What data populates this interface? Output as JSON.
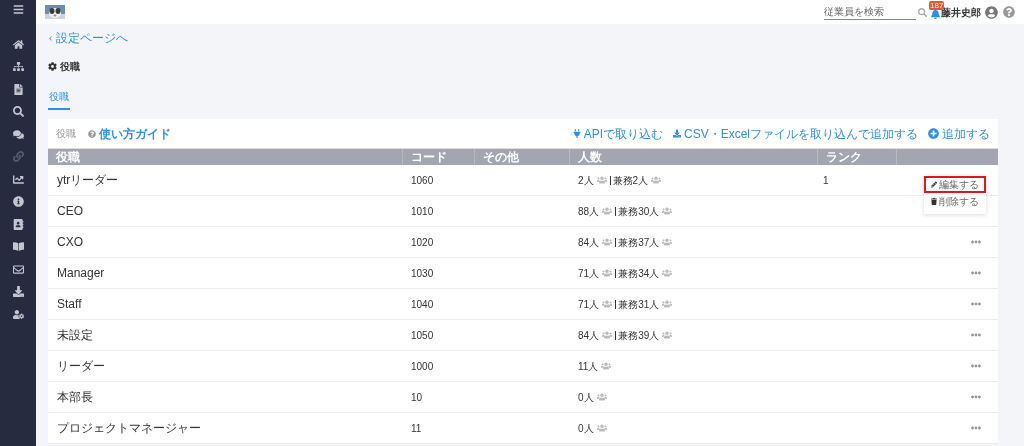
{
  "header": {
    "search": {
      "placeholder": "従業員を検索"
    },
    "notifications": {
      "count": "187"
    },
    "user": {
      "name": "藤井史郎"
    }
  },
  "sidebar": {
    "items": [
      {
        "kind": "menu"
      },
      {
        "kind": "home"
      },
      {
        "kind": "org"
      },
      {
        "kind": "file"
      },
      {
        "kind": "search"
      },
      {
        "kind": "chat"
      },
      {
        "kind": "link"
      },
      {
        "kind": "chart"
      },
      {
        "kind": "info"
      },
      {
        "kind": "contact"
      },
      {
        "kind": "book"
      },
      {
        "kind": "mail"
      },
      {
        "kind": "download"
      },
      {
        "kind": "usercog"
      }
    ]
  },
  "breadcrumb": "設定ページへ",
  "page_title": "役職",
  "tabs": [
    {
      "label": "役職",
      "selected": true
    }
  ],
  "toolbar": {
    "title": "役職",
    "guide": "使い方ガイド",
    "actions": [
      {
        "kind": "api",
        "label": "APIで取り込む"
      },
      {
        "kind": "import",
        "label": "CSV・Excelファイルを取り込んで追加する"
      },
      {
        "kind": "add",
        "label": "追加する"
      }
    ]
  },
  "table": {
    "columns": [
      "役職",
      "コード",
      "その他",
      "人数",
      "ランク"
    ],
    "rows": [
      {
        "name": "ytrリーダー",
        "code": "1060",
        "count": "2人",
        "concurrent": "兼務2人",
        "rank": "1",
        "menu": [
          {
            "kind": "edit",
            "label": "編集する",
            "highlighted": true
          },
          {
            "kind": "delete",
            "label": "削除する",
            "highlighted": false
          }
        ]
      },
      {
        "name": "CEO",
        "code": "1010",
        "count": "88人",
        "concurrent": "兼務30人"
      },
      {
        "name": "CXO",
        "code": "1020",
        "count": "84人",
        "concurrent": "兼務37人"
      },
      {
        "name": "Manager",
        "code": "1030",
        "count": "71人",
        "concurrent": "兼務34人"
      },
      {
        "name": "Staff",
        "code": "1040",
        "count": "71人",
        "concurrent": "兼務31人"
      },
      {
        "name": "未設定",
        "code": "1050",
        "count": "84人",
        "concurrent": "兼務39人"
      },
      {
        "name": "リーダー",
        "code": "1000",
        "count": "11人"
      },
      {
        "name": "本部長",
        "code": "10",
        "count": "0人"
      },
      {
        "name": "プロジェクトマネージャー",
        "code": "11",
        "count": "0人"
      }
    ]
  }
}
